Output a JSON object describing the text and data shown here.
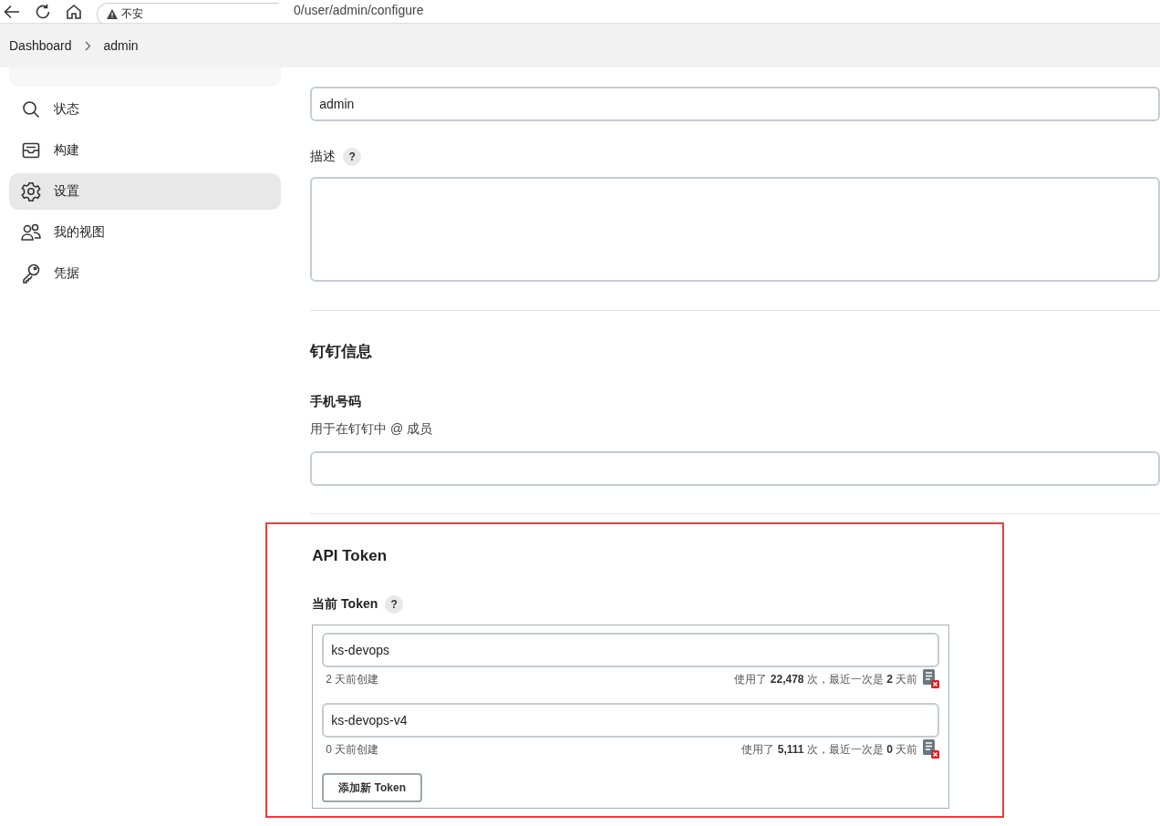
{
  "browser": {
    "security_label": "不安",
    "url": "0/user/admin/configure"
  },
  "breadcrumb": [
    "Dashboard",
    "admin"
  ],
  "sidebar": {
    "items": [
      {
        "label": "状态",
        "selected": false
      },
      {
        "label": "构建",
        "selected": false
      },
      {
        "label": "设置",
        "selected": true
      },
      {
        "label": "我的视图",
        "selected": false
      },
      {
        "label": "凭据",
        "selected": false
      }
    ]
  },
  "account": {
    "name_value": "admin",
    "description_label": "描述",
    "help": "?"
  },
  "dingtalk": {
    "heading": "钉钉信息",
    "phone_label": "手机号码",
    "phone_hint": "用于在钉钉中 @ 成员"
  },
  "api_token": {
    "highlighted": true,
    "heading": "API Token",
    "current_label": "当前 Token",
    "help": "?",
    "tokens": [
      {
        "name": "ks-devops",
        "created": "2 天前创建",
        "usage": "使用了 **22,478** 次，最近一次是 **2** 天前"
      },
      {
        "name": "ks-devops-v4",
        "created": "0 天前创建",
        "usage": "使用了 **5,111** 次，最近一次是 **0** 天前"
      }
    ],
    "add_button": "添加新 Token"
  }
}
